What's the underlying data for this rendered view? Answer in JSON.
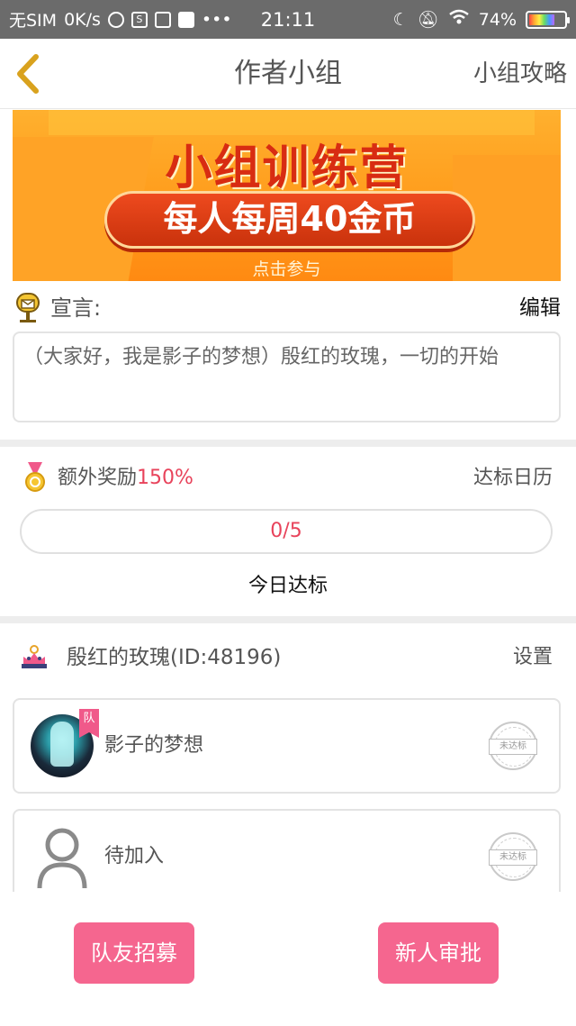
{
  "status_bar": {
    "carrier": "无SIM",
    "speed": "0K/s",
    "time": "21:11",
    "battery": "74%",
    "battery_level": 0.74
  },
  "nav": {
    "title": "作者小组",
    "right_label": "小组攻略"
  },
  "banner": {
    "title": "小组训练营",
    "pill_text": "每人每周40金币",
    "sub": "点击参与"
  },
  "declaration": {
    "label": "宣言:",
    "edit_label": "编辑",
    "text": "（大家好，我是影子的梦想）殷红的玫瑰，一切的开始"
  },
  "reward": {
    "text": "额外奖励",
    "percent": "150%",
    "calendar_label": "达标日历",
    "progress_text": "0/5",
    "progress_value": 0,
    "today_label": "今日达标"
  },
  "team": {
    "name": "殷红的玫瑰(ID:48196)",
    "settings_label": "设置",
    "members": [
      {
        "name": "影子的梦想",
        "badge": "队",
        "status": "未达标"
      },
      {
        "name": "待加入",
        "status": "未达标"
      }
    ]
  },
  "footer": {
    "recruit_label": "队友招募",
    "approve_label": "新人审批"
  },
  "colors": {
    "accent_pink": "#f5668f",
    "highlight_red": "#e8435b",
    "banner_orange": "#ff9a1a"
  }
}
